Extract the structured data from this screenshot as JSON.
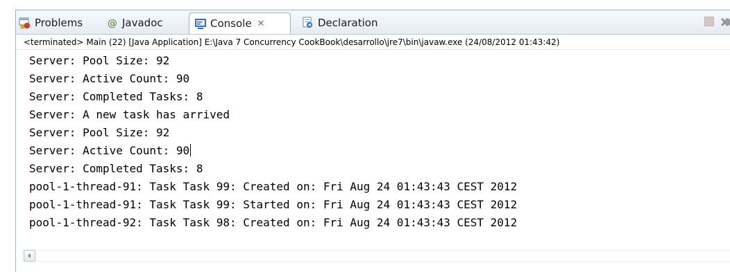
{
  "tabs": [
    {
      "label": "Problems",
      "icon": "problems-icon"
    },
    {
      "label": "Javadoc",
      "icon": "javadoc-icon"
    },
    {
      "label": "Console",
      "icon": "console-icon",
      "active": true,
      "close": "✕"
    },
    {
      "label": "Declaration",
      "icon": "declaration-icon"
    }
  ],
  "status": "<terminated> Main (22) [Java Application] E:\\Java 7 Concurrency CookBook\\desarrollo\\jre7\\bin\\javaw.exe (24/08/2012 01:43:42)",
  "console": {
    "lines": [
      "Server: Pool Size: 92",
      "Server: Active Count: 90",
      "Server: Completed Tasks: 8",
      "Server: A new task has arrived",
      "Server: Pool Size: 92",
      "Server: Active Count: 90",
      "Server: Completed Tasks: 8",
      "pool-1-thread-91: Task Task 99: Created on: Fri Aug 24 01:43:43 CEST 2012",
      "pool-1-thread-91: Task Task 99: Started on: Fri Aug 24 01:43:43 CEST 2012",
      "pool-1-thread-92: Task Task 98: Created on: Fri Aug 24 01:43:43 CEST 2012"
    ]
  },
  "colors": {
    "terminate_button": "#d9c6c6",
    "remove_button": "#9a9a9a",
    "console_icon": "#3a6cb4"
  }
}
